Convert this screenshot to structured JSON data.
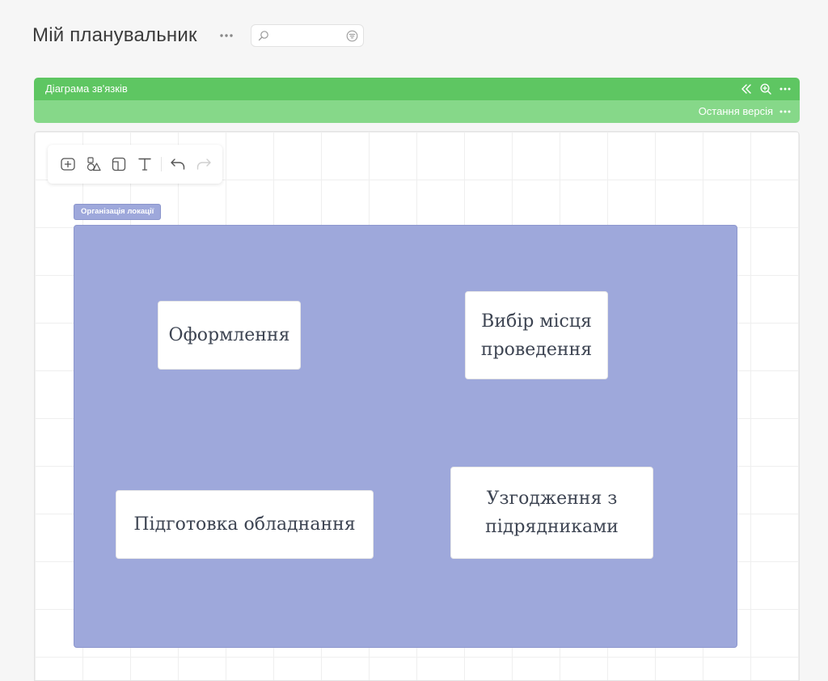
{
  "page": {
    "title": "Мій планувальник"
  },
  "search": {
    "value": "",
    "placeholder": ""
  },
  "panel": {
    "title": "Діаграма зв'язків",
    "version_label": "Остання версія",
    "header_color": "#5ec662",
    "subheader_color": "#86d889",
    "header_icons": [
      "collapse-icon",
      "zoom-in-icon",
      "more-icon"
    ]
  },
  "toolbar": {
    "tools": [
      "add-node-icon",
      "shapes-icon",
      "frame-icon",
      "text-icon",
      "undo-icon",
      "redo-icon"
    ]
  },
  "diagram": {
    "frame_label": "Організація локації",
    "frame_color": "#9ea8db",
    "nodes": [
      {
        "label": "Оформлення"
      },
      {
        "label": "Вибір місця проведення"
      },
      {
        "label": "Підготовка обладнання"
      },
      {
        "label": "Узгодження з підрядниками"
      }
    ]
  }
}
